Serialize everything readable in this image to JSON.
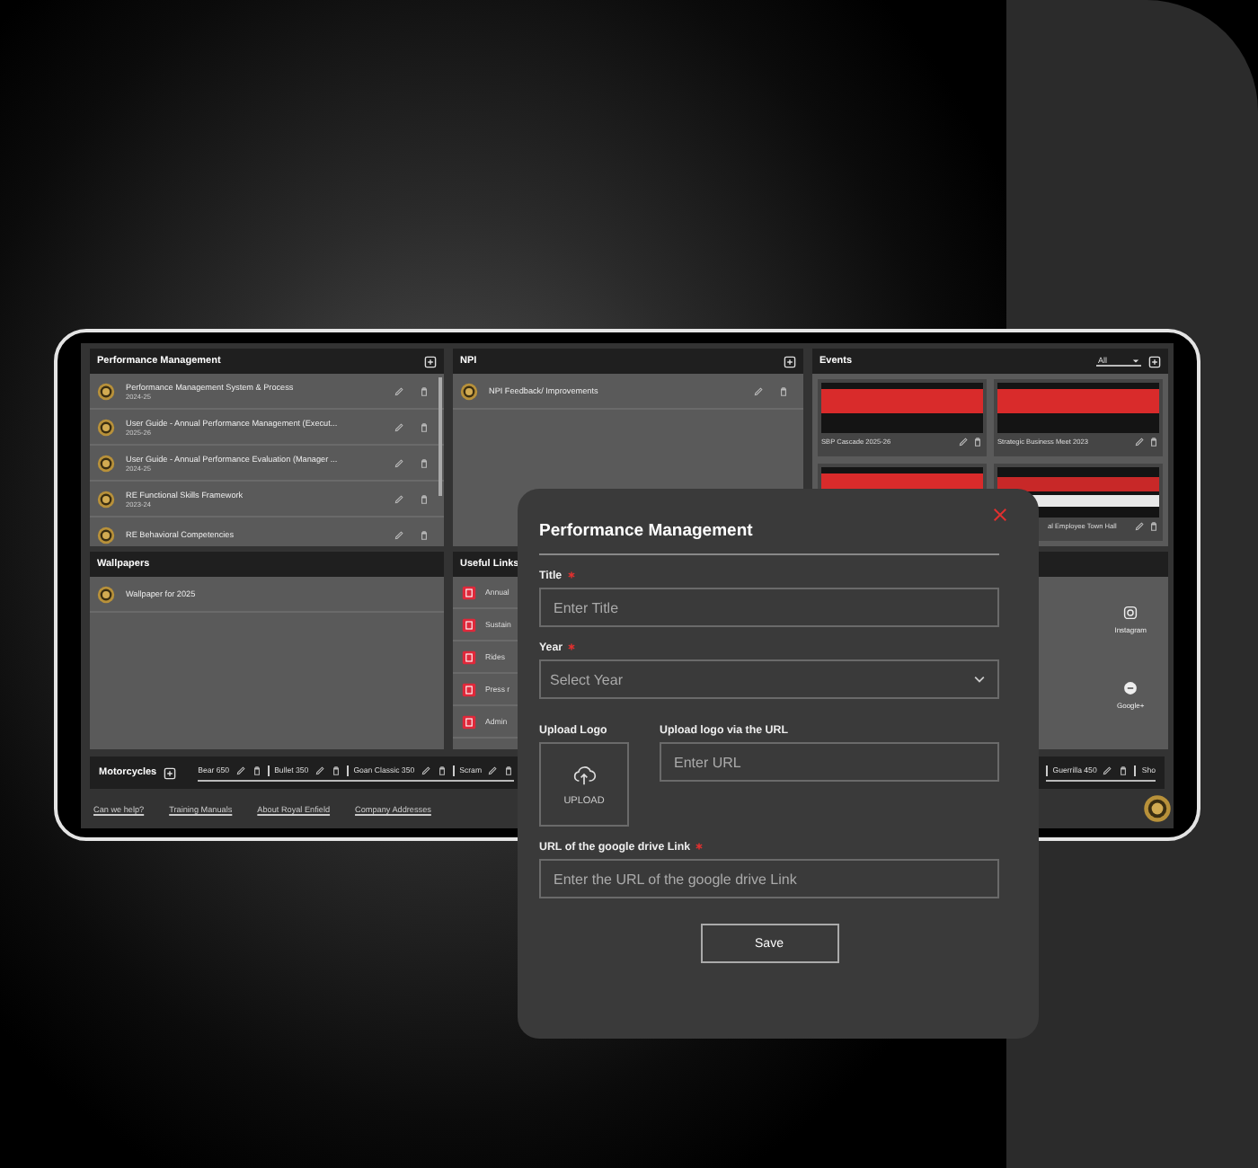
{
  "dashboard": {
    "panels": [
      {
        "kind": "documents",
        "title": "Performance Management",
        "add": true,
        "items": [
          {
            "title": "Performance Management System & Process",
            "year": "2024-25"
          },
          {
            "title": "User Guide - Annual Performance Management (Execut...",
            "year": "2025-26"
          },
          {
            "title": "User Guide - Annual Performance Evaluation (Manager ...",
            "year": "2024-25"
          },
          {
            "title": "RE Functional Skills Framework",
            "year": "2023-24"
          },
          {
            "title": "RE Behavioral Competencies"
          }
        ]
      },
      {
        "kind": "documents",
        "title": "NPI",
        "add": true,
        "items": [
          {
            "title": "NPI Feedback/ Improvements"
          }
        ]
      },
      {
        "kind": "events",
        "title": "Events",
        "filter": "All",
        "add": true,
        "items": [
          {
            "kind": "sbp",
            "caption": "SBP Cascade 2025-26"
          },
          {
            "kind": "sbp",
            "caption": "Strategic Business Meet 2023"
          },
          {
            "kind": "sbp"
          },
          {
            "kind": "town_hall",
            "caption": "al Employee Town Hall"
          }
        ]
      },
      {
        "kind": "documents",
        "title": "Wallpapers",
        "items": [
          {
            "title": "Wallpaper for 2025"
          }
        ]
      },
      {
        "kind": "links",
        "title": "Useful Links",
        "items": [
          {
            "label": "Annual"
          },
          {
            "label": "Sustain"
          },
          {
            "label": "Rides"
          },
          {
            "label": "Press r"
          },
          {
            "label": "Admin"
          }
        ]
      },
      {
        "kind": "social",
        "items": [
          {
            "label": "Instagram"
          },
          {
            "label": "Google+"
          }
        ]
      }
    ],
    "motorcycles": {
      "title": "Motorcycles",
      "left": [
        "Bear 650",
        "Bullet 350",
        "Goan Classic 350",
        "Scram"
      ],
      "right": [
        "Guerrilla 450",
        "Sho"
      ]
    },
    "footer_links": [
      "Can we help?",
      "Training Manuals",
      "About Royal Enfield",
      "Company Addresses"
    ]
  },
  "modal": {
    "title": "Performance Management",
    "title_field": {
      "label": "Title",
      "required": true,
      "placeholder": "Enter Title"
    },
    "year_field": {
      "label": "Year",
      "required": true,
      "placeholder": "Select Year"
    },
    "logo_upload": {
      "label": "Upload Logo",
      "button": "UPLOAD"
    },
    "logo_url": {
      "label": "Upload logo via the URL",
      "placeholder": "Enter URL"
    },
    "drive_field": {
      "label": "URL of the google drive Link",
      "required": true,
      "placeholder": "Enter the URL of the google drive Link"
    },
    "save": "Save"
  }
}
